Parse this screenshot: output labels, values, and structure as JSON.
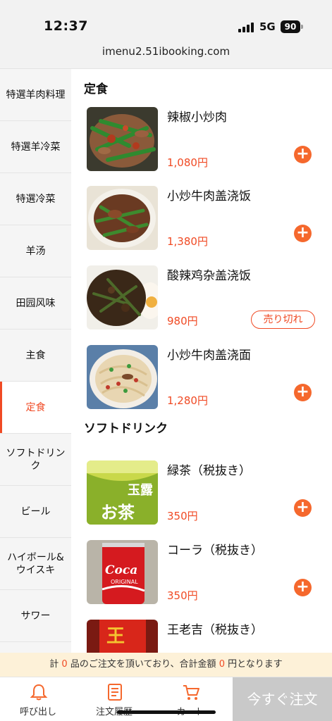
{
  "status": {
    "time": "12:37",
    "network": "5G",
    "battery": "90"
  },
  "browser": {
    "url": "imenu2.51ibooking.com"
  },
  "colors": {
    "accent": "#f04a24",
    "add_button": "#f5682d",
    "notice_bg": "#fdf1d8",
    "order_button": "#c9c9c9"
  },
  "sidebar": {
    "items": [
      {
        "label": "特選羊肉料理",
        "active": false
      },
      {
        "label": "特選羊冷菜",
        "active": false
      },
      {
        "label": "特選冷菜",
        "active": false
      },
      {
        "label": "羊汤",
        "active": false
      },
      {
        "label": "田园风味",
        "active": false
      },
      {
        "label": "主食",
        "active": false
      },
      {
        "label": "定食",
        "active": true
      },
      {
        "label": "ソフトドリンク",
        "active": false
      },
      {
        "label": "ビール",
        "active": false
      },
      {
        "label": "ハイボール&ウイスキ",
        "active": false
      },
      {
        "label": "サワー",
        "active": false
      }
    ]
  },
  "sections": [
    {
      "title": "定食",
      "items": [
        {
          "name": "辣椒小炒肉",
          "price": "1,080円",
          "sold_out": false,
          "image": "stir-fry-pork-peppers"
        },
        {
          "name": "小炒牛肉盖浇饭",
          "price": "1,380円",
          "sold_out": false,
          "image": "beef-rice-plate"
        },
        {
          "name": "酸辣鸡杂盖浇饭",
          "price": "980円",
          "sold_out": true,
          "sold_out_label": "売り切れ",
          "image": "chicken-giblets-rice"
        },
        {
          "name": "小炒牛肉盖浇面",
          "price": "1,280円",
          "sold_out": false,
          "image": "beef-noodles"
        }
      ]
    },
    {
      "title": "ソフトドリンク",
      "items": [
        {
          "name": "緑茶（税抜き）",
          "price": "350円",
          "sold_out": false,
          "image": "green-tea-bottle",
          "image_text": "玉露入お茶"
        },
        {
          "name": "コーラ（税抜き）",
          "price": "350円",
          "sold_out": false,
          "image": "cola-can",
          "image_text": "Coca-Cola"
        },
        {
          "name": "王老吉（税抜き）",
          "price": "",
          "sold_out": false,
          "image": "wanglaoji-can",
          "image_text": "王老"
        }
      ]
    }
  ],
  "cart_notice": {
    "prefix": "計",
    "count": "0",
    "middle": "品のご注文を頂いており、合計金額",
    "amount": "0",
    "suffix": "円となります"
  },
  "tabbar": {
    "call": "呼び出し",
    "history": "注文履歴",
    "cart": "カート",
    "order_now": "今すぐ注文"
  }
}
